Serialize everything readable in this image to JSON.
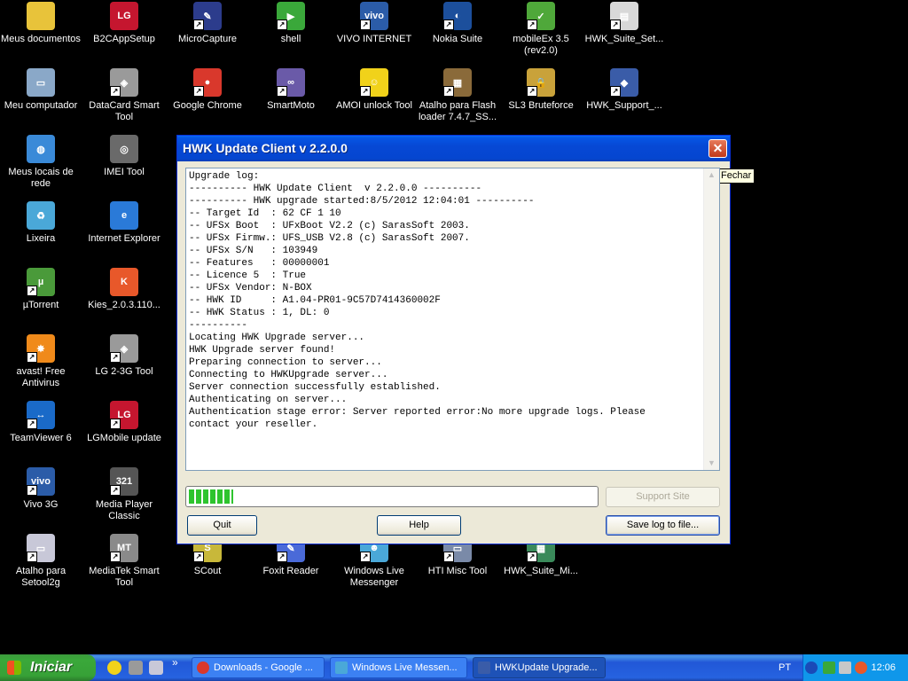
{
  "desktop": {
    "icons": [
      {
        "label": "Meus documentos",
        "name": "icon-meus-documentos",
        "glyph": "",
        "color": "#e8c33a",
        "shortcut": false
      },
      {
        "label": "B2CAppSetup",
        "name": "icon-b2cappsetup",
        "glyph": "LG",
        "color": "#c5162f",
        "shortcut": false
      },
      {
        "label": "MicroCapture",
        "name": "icon-microcapture",
        "glyph": "✎",
        "color": "#2c3c8c",
        "shortcut": true
      },
      {
        "label": "shell",
        "name": "icon-shell",
        "glyph": "▶",
        "color": "#3aa83a",
        "shortcut": true
      },
      {
        "label": "VIVO INTERNET",
        "name": "icon-vivo-internet",
        "glyph": "vivo",
        "color": "#2b5ca8",
        "shortcut": true
      },
      {
        "label": "Nokia Suite",
        "name": "icon-nokia-suite",
        "glyph": "◐",
        "color": "#1c4f9c",
        "shortcut": true
      },
      {
        "label": "mobileEx 3.5 (rev2.0)",
        "name": "icon-mobileex",
        "glyph": "✓",
        "color": "#4fa83a",
        "shortcut": true
      },
      {
        "label": "HWK_Suite_Set...",
        "name": "icon-hwk-suite-setup",
        "glyph": "▤",
        "color": "#d8d8d8",
        "shortcut": true
      },
      {
        "label": "Meu computador",
        "name": "icon-meu-computador",
        "glyph": "▭",
        "color": "#8aa8c8",
        "shortcut": false
      },
      {
        "label": "DataCard Smart Tool",
        "name": "icon-datacard-smart-tool",
        "glyph": "◈",
        "color": "#9a9a9a",
        "shortcut": true
      },
      {
        "label": "Google Chrome",
        "name": "icon-google-chrome",
        "glyph": "●",
        "color": "#d9382c",
        "shortcut": true
      },
      {
        "label": "SmartMoto",
        "name": "icon-smartmoto",
        "glyph": "∞",
        "color": "#6a5aa8",
        "shortcut": true
      },
      {
        "label": "AMOI unlock Tool",
        "name": "icon-amoi-unlock-tool",
        "glyph": "☺",
        "color": "#f1d21a",
        "shortcut": true
      },
      {
        "label": "Atalho para Flash loader 7.4.7_SS...",
        "name": "icon-flash-loader",
        "glyph": "▦",
        "color": "#8a6a3a",
        "shortcut": true
      },
      {
        "label": "SL3 Bruteforce",
        "name": "icon-sl3-bruteforce",
        "glyph": "🔒",
        "color": "#c9a23a",
        "shortcut": true
      },
      {
        "label": "HWK_Support_...",
        "name": "icon-hwk-support",
        "glyph": "◆",
        "color": "#3a5ca8",
        "shortcut": true
      },
      {
        "label": "Meus locais de rede",
        "name": "icon-meus-locais-de-rede",
        "glyph": "◍",
        "color": "#3a8ad8",
        "shortcut": false
      },
      {
        "label": "IMEI Tool",
        "name": "icon-imei-tool",
        "glyph": "◎",
        "color": "#6a6a6a",
        "shortcut": false
      },
      {
        "label": "Lixeira",
        "name": "icon-lixeira",
        "glyph": "♻",
        "color": "#4aa8d8",
        "shortcut": false
      },
      {
        "label": "Internet Explorer",
        "name": "icon-internet-explorer",
        "glyph": "e",
        "color": "#2a7ad8",
        "shortcut": false
      },
      {
        "label": "µTorrent",
        "name": "icon-utorrent",
        "glyph": "µ",
        "color": "#4a9a3a",
        "shortcut": true
      },
      {
        "label": "Kies_2.0.3.110...",
        "name": "icon-kies",
        "glyph": "K",
        "color": "#e8582a",
        "shortcut": false
      },
      {
        "label": "avast! Free Antivirus",
        "name": "icon-avast",
        "glyph": "✸",
        "color": "#f08a1a",
        "shortcut": true
      },
      {
        "label": "LG 2-3G Tool",
        "name": "icon-lg-23g-tool",
        "glyph": "◈",
        "color": "#9a9a9a",
        "shortcut": true
      },
      {
        "label": "TeamViewer 6",
        "name": "icon-teamviewer",
        "glyph": "↔",
        "color": "#1a6ac8",
        "shortcut": true
      },
      {
        "label": "LGMobile update",
        "name": "icon-lgmobile-update",
        "glyph": "LG",
        "color": "#c5162f",
        "shortcut": true
      },
      {
        "label": "Vivo 3G",
        "name": "icon-vivo-3g",
        "glyph": "vivo",
        "color": "#2b5ca8",
        "shortcut": true
      },
      {
        "label": "Media Player Classic",
        "name": "icon-media-player-classic",
        "glyph": "321",
        "color": "#555555",
        "shortcut": true
      },
      {
        "label": "Atalho para Setool2g",
        "name": "icon-setool2g",
        "glyph": "▭",
        "color": "#c8c8d8",
        "shortcut": true
      },
      {
        "label": "MediaTek Smart Tool",
        "name": "icon-mediatek-smart-tool",
        "glyph": "MT",
        "color": "#8a8a8a",
        "shortcut": true
      },
      {
        "label": "SCout",
        "name": "icon-scout",
        "glyph": "S",
        "color": "#c8b83a",
        "shortcut": true
      },
      {
        "label": "Foxit Reader",
        "name": "icon-foxit-reader",
        "glyph": "✎",
        "color": "#4a6ad8",
        "shortcut": true
      },
      {
        "label": "Windows Live Messenger",
        "name": "icon-windows-live-messenger",
        "glyph": "☻",
        "color": "#4aa8d8",
        "shortcut": true
      },
      {
        "label": "HTI Misc Tool",
        "name": "icon-hti-misc-tool",
        "glyph": "▭",
        "color": "#7a8aa8",
        "shortcut": true
      },
      {
        "label": "HWK_Suite_Mi...",
        "name": "icon-hwk-suite-mi",
        "glyph": "▦",
        "color": "#3a8a5a",
        "shortcut": true
      }
    ]
  },
  "dialog": {
    "title": "HWK Update Client  v 2.2.0.0",
    "close_tooltip": "Fechar",
    "log": "Upgrade log:\n---------- HWK Update Client  v 2.2.0.0 ----------\n---------- HWK upgrade started:8/5/2012 12:04:01 ----------\n-- Target Id  : 62 CF 1 10\n-- UFSx Boot  : UFxBoot V2.2 (c) SarasSoft 2003.\n-- UFSx Firmw.: UFS_USB V2.8 (c) SarasSoft 2007.\n-- UFSx S/N   : 103949\n-- Features   : 00000001\n-- Licence 5  : True\n-- UFSx Vendor: N-BOX\n-- HWK ID     : A1.04-PR01-9C57D7414360002F\n-- HWK Status : 1, DL: 0\n----------\nLocating HWK Upgrade server...\nHWK Upgrade server found!\nPreparing connection to server...\nConnecting to HWKUpgrade server...\nServer connection successfully established.\nAuthenticating on server...\nAuthentication stage error: Server reported error:No more upgrade logs. Please\ncontact your reseller.",
    "progress_fraction": 0.11,
    "support_site_label": "Support Site",
    "quit_label": "Quit",
    "help_label": "Help",
    "save_log_label": "Save log to file..."
  },
  "taskbar": {
    "start_label": "Iniciar",
    "more_glyph": "»",
    "tasks": [
      {
        "label": "Downloads - Google ...",
        "name": "task-chrome-downloads"
      },
      {
        "label": "Windows Live Messen...",
        "name": "task-windows-live-messenger"
      },
      {
        "label": "HWKUpdate Upgrade...",
        "name": "task-hwkupdate"
      }
    ],
    "language": "PT",
    "clock": "12:06"
  }
}
